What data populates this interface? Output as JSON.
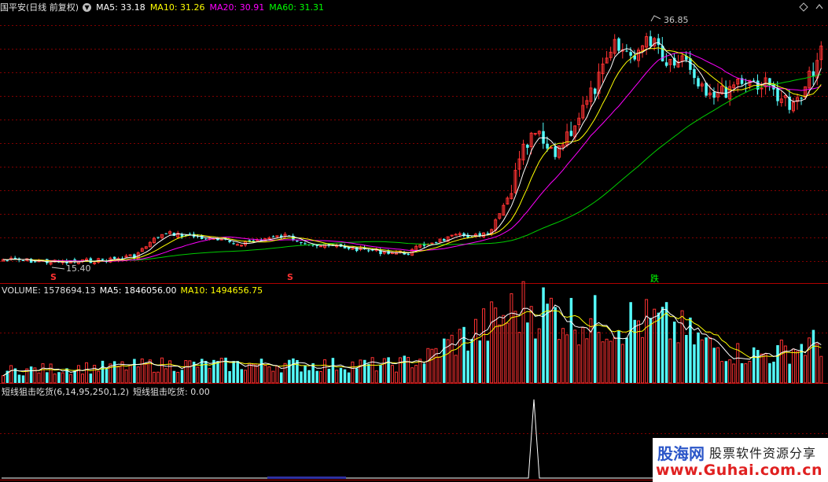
{
  "header": {
    "title": "国平安(日线 前复权)",
    "ma5": "MA5: 33.18",
    "ma10": "MA10: 31.26",
    "ma20": "MA20: 30.91",
    "ma60": "MA60: 31.31"
  },
  "price_chart": {
    "high_label": "36.85",
    "low_label": "15.40",
    "signals": [
      "S",
      "S",
      "跌"
    ]
  },
  "volume_panel": {
    "label": "VOLUME: 1578694.13",
    "ma5": "MA5: 1846056.00",
    "ma10": "MA10: 1494656.75"
  },
  "indicator_panel": {
    "label": "短线狙击吃货(6,14,95,250,1,2)",
    "value": "短线狙击吃货: 0.00"
  },
  "watermark": {
    "logo": "股海网",
    "slogan": "股票软件资源分享",
    "url": "www.Guhai.com.cn"
  },
  "colors": {
    "ma5": "#ffffff",
    "ma10": "#ffff00",
    "ma20": "#ff00ff",
    "ma60": "#00cc00",
    "up": "#ff3232",
    "down": "#54fcfc",
    "grid": "#800000"
  }
}
